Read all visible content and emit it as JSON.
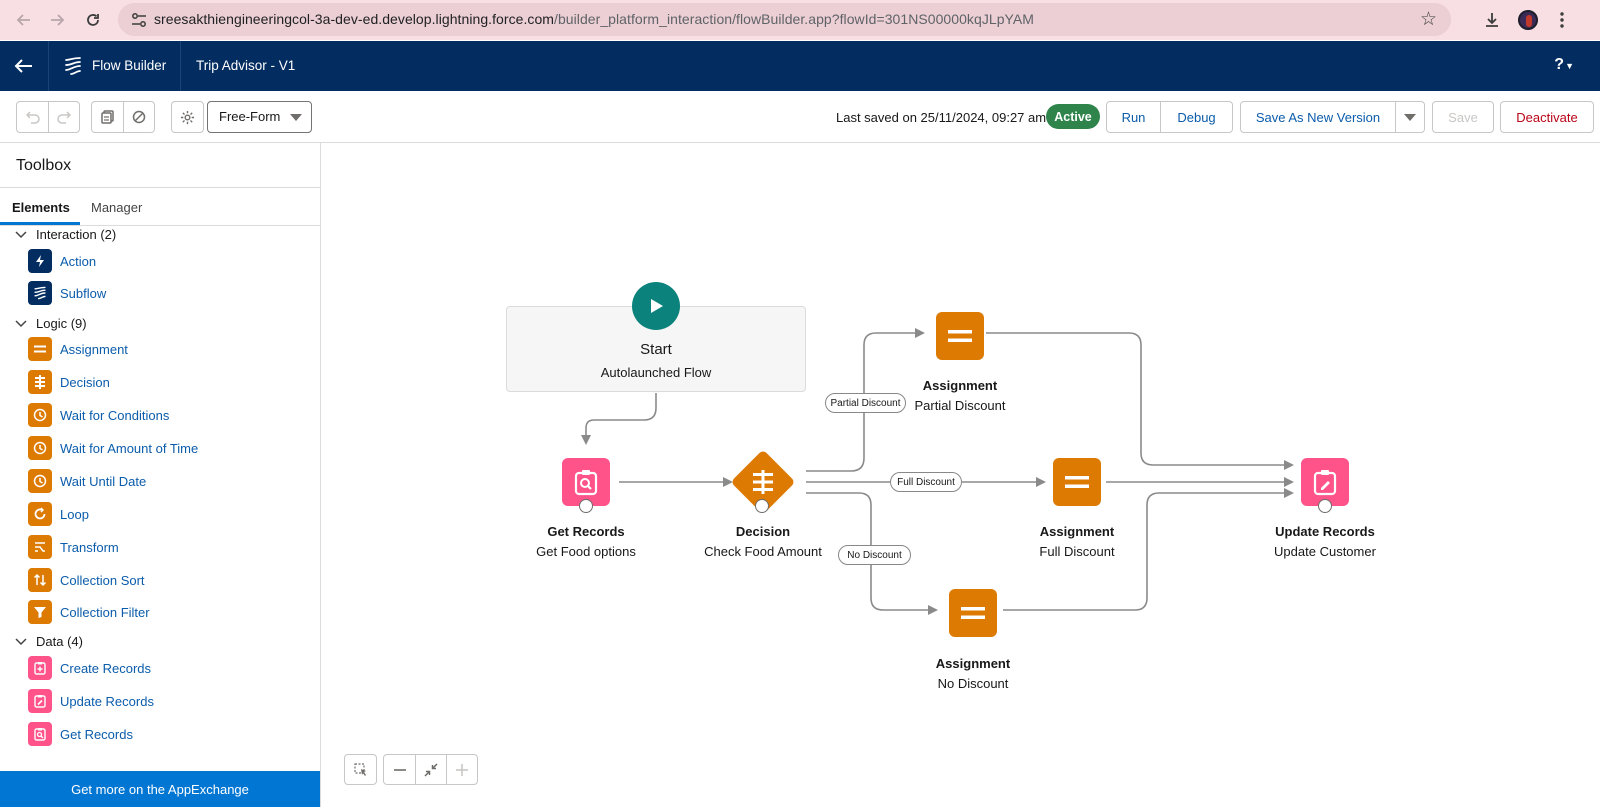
{
  "browser": {
    "url_host": "sreesakthiengineeringcol-3a-dev-ed.develop.lightning.force.com",
    "url_path": "/builder_platform_interaction/flowBuilder.app?flowId=301NS00000kqJLpYAM"
  },
  "header": {
    "app_name": "Flow Builder",
    "flow_name": "Trip Advisor - V1",
    "help_label": "?"
  },
  "toolbar": {
    "canvas_mode": "Free-Form",
    "last_saved": "Last saved on 25/11/2024, 09:27 am",
    "status_badge": "Active",
    "run_label": "Run",
    "debug_label": "Debug",
    "save_as_new_label": "Save As New Version",
    "save_label": "Save",
    "deactivate_label": "Deactivate"
  },
  "toolbox": {
    "title": "Toolbox",
    "tabs": [
      "Elements",
      "Manager"
    ],
    "sections": [
      {
        "label": "Interaction (2)",
        "items": [
          {
            "label": "Action",
            "icon": "lightning-icon",
            "color": "#032d60"
          },
          {
            "label": "Subflow",
            "icon": "subflow-icon",
            "color": "#032d60"
          }
        ]
      },
      {
        "label": "Logic (9)",
        "items": [
          {
            "label": "Assignment",
            "icon": "assignment-icon",
            "color": "#dd7a01"
          },
          {
            "label": "Decision",
            "icon": "decision-icon",
            "color": "#dd7a01"
          },
          {
            "label": "Wait for Conditions",
            "icon": "clock-icon",
            "color": "#dd7a01"
          },
          {
            "label": "Wait for Amount of Time",
            "icon": "clock-icon",
            "color": "#dd7a01"
          },
          {
            "label": "Wait Until Date",
            "icon": "clock-icon",
            "color": "#dd7a01"
          },
          {
            "label": "Loop",
            "icon": "loop-icon",
            "color": "#dd7a01"
          },
          {
            "label": "Transform",
            "icon": "transform-icon",
            "color": "#dd7a01"
          },
          {
            "label": "Collection Sort",
            "icon": "sort-icon",
            "color": "#dd7a01"
          },
          {
            "label": "Collection Filter",
            "icon": "filter-icon",
            "color": "#dd7a01"
          }
        ]
      },
      {
        "label": "Data (4)",
        "items": [
          {
            "label": "Create Records",
            "icon": "record-create-icon",
            "color": "#ff538a"
          },
          {
            "label": "Update Records",
            "icon": "record-update-icon",
            "color": "#ff538a"
          },
          {
            "label": "Get Records",
            "icon": "record-lookup-icon",
            "color": "#ff538a"
          }
        ]
      }
    ],
    "appexchange_label": "Get more on the AppExchange"
  },
  "canvas": {
    "start": {
      "title": "Start",
      "subtitle": "Autolaunched Flow"
    },
    "nodes": {
      "get_records": {
        "type": "Get Records",
        "label": "Get Food options"
      },
      "decision": {
        "type": "Decision",
        "label": "Check Food Amount"
      },
      "assign_partial": {
        "type": "Assignment",
        "label": "Partial Discount"
      },
      "assign_full": {
        "type": "Assignment",
        "label": "Full Discount"
      },
      "assign_none": {
        "type": "Assignment",
        "label": "No Discount"
      },
      "update_records": {
        "type": "Update Records",
        "label": "Update Customer"
      }
    },
    "outcomes": {
      "partial": "Partial Discount",
      "full": "Full Discount",
      "none": "No Discount"
    }
  }
}
